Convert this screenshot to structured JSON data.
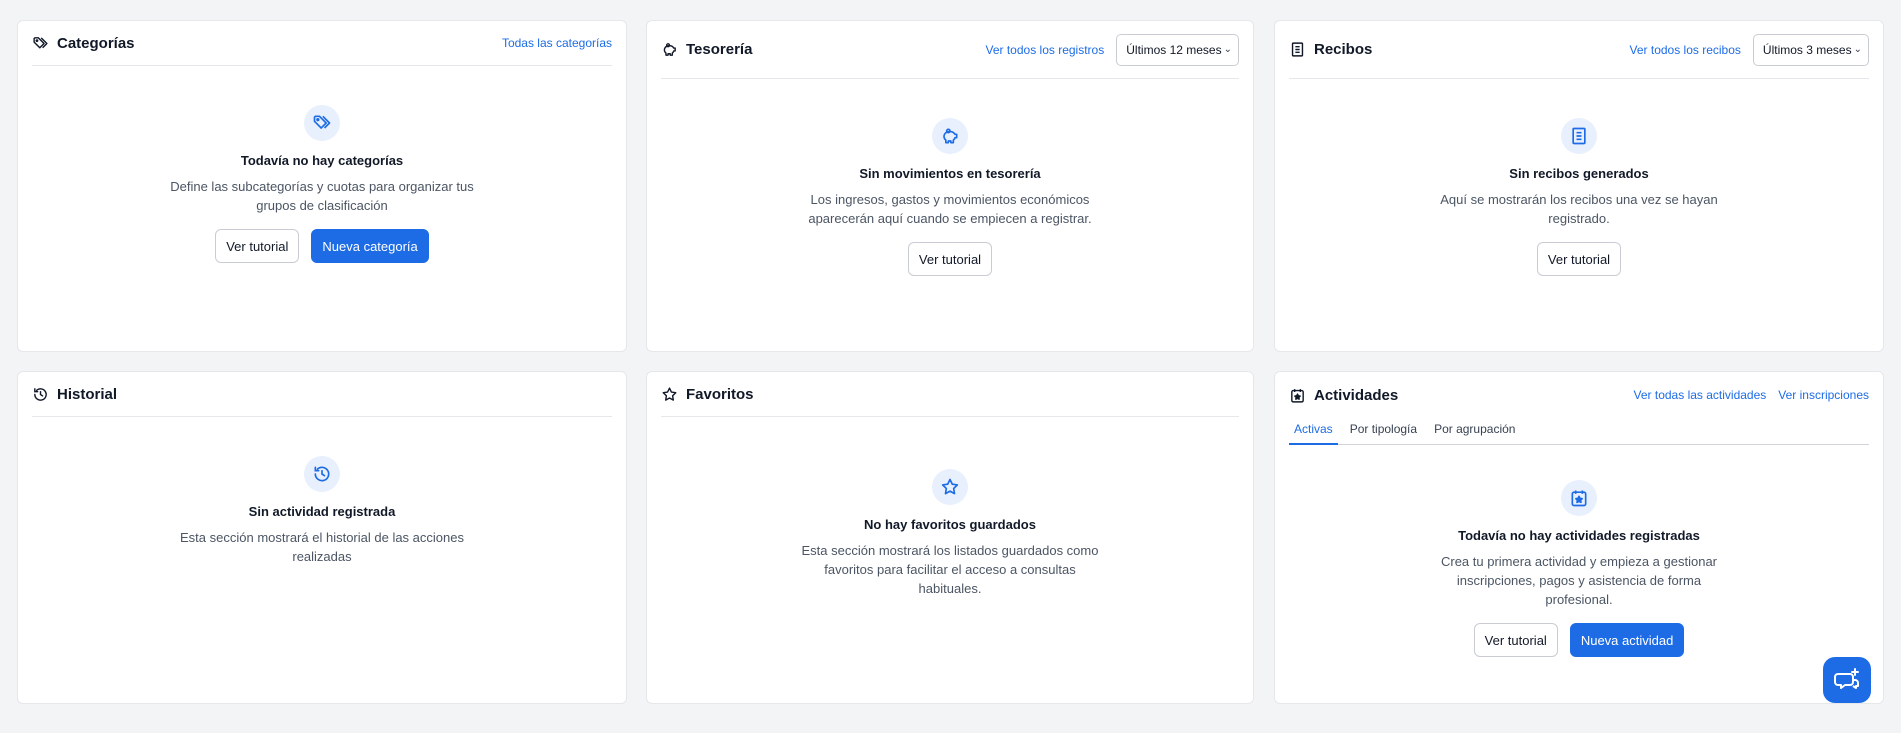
{
  "colors": {
    "accent": "#1d6ce6",
    "icon_bg": "#e8f0fd",
    "page_bg": "#f3f4f6"
  },
  "categorias": {
    "title": "Categorías",
    "link": "Todas las categorías",
    "empty_title": "Todavía no hay categorías",
    "empty_text_1": "Define las subcategorías y cuotas para organizar tus",
    "empty_text_2": "grupos de clasificación",
    "btn_tutorial": "Ver tutorial",
    "btn_primary": "Nueva categoría"
  },
  "tesoreria": {
    "title": "Tesorería",
    "link": "Ver todos los registros",
    "select_value": "Últimos 12 meses",
    "empty_title": "Sin movimientos en tesorería",
    "empty_text_1": "Los ingresos, gastos y movimientos económicos",
    "empty_text_2": "aparecerán aquí cuando se empiecen a registrar.",
    "btn_tutorial": "Ver tutorial"
  },
  "recibos": {
    "title": "Recibos",
    "link": "Ver todos los recibos",
    "select_value": "Últimos 3 meses",
    "empty_title": "Sin recibos generados",
    "empty_text_1": "Aquí se mostrarán los recibos una vez se hayan",
    "empty_text_2": "registrado.",
    "btn_tutorial": "Ver tutorial"
  },
  "historial": {
    "title": "Historial",
    "empty_title": "Sin actividad registrada",
    "empty_text_1": "Esta sección mostrará el historial de las acciones",
    "empty_text_2": "realizadas"
  },
  "favoritos": {
    "title": "Favoritos",
    "empty_title": "No hay favoritos guardados",
    "empty_text_1": "Esta sección mostrará los listados guardados como",
    "empty_text_2": "favoritos para facilitar el acceso a consultas",
    "empty_text_3": "habituales."
  },
  "actividades": {
    "title": "Actividades",
    "link_1": "Ver todas las actividades",
    "link_2": "Ver inscripciones",
    "tabs": [
      {
        "label": "Activas",
        "active": true
      },
      {
        "label": "Por tipología",
        "active": false
      },
      {
        "label": "Por agrupación",
        "active": false
      }
    ],
    "empty_title": "Todavía no hay actividades registradas",
    "empty_text_1": "Crea tu primera actividad y empieza a gestionar",
    "empty_text_2": "inscripciones, pagos y asistencia de forma",
    "empty_text_3": "profesional.",
    "btn_tutorial": "Ver tutorial",
    "btn_primary": "Nueva actividad"
  },
  "icons": {
    "categorias": "tags-icon",
    "tesoreria": "piggy-bank-icon",
    "recibos": "receipt-icon",
    "historial": "history-icon",
    "favoritos": "star-icon",
    "actividades": "calendar-star-icon",
    "chat": "chat-support-icon"
  }
}
